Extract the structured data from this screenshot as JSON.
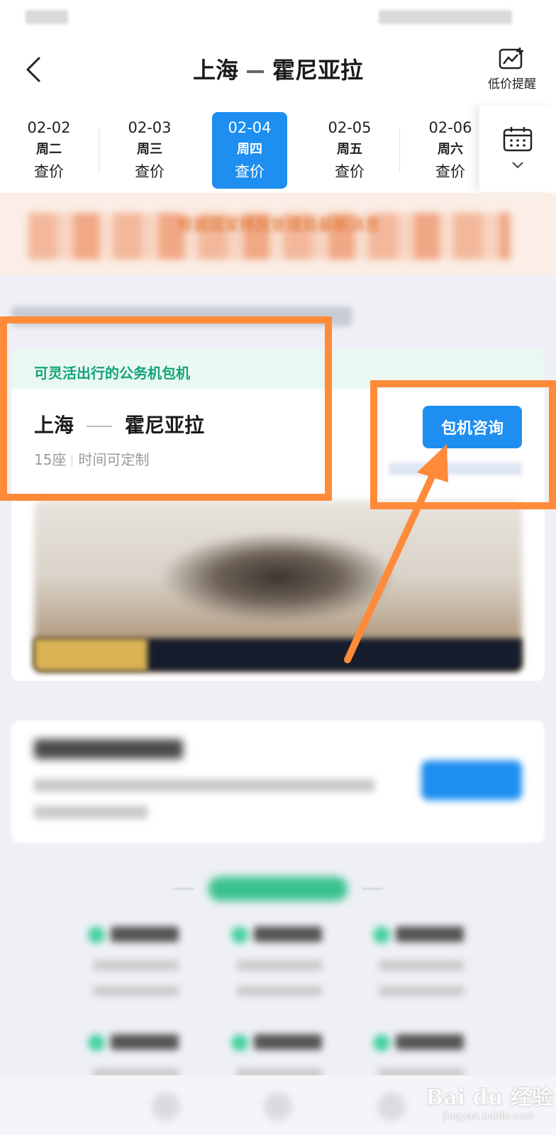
{
  "header": {
    "title_from": "上海",
    "title_to": "霍尼亚拉",
    "price_alert_label": "低价提醒"
  },
  "date_tabs": [
    {
      "date": "02-02",
      "weekday": "周二",
      "price": "查价",
      "active": false
    },
    {
      "date": "02-03",
      "weekday": "周三",
      "price": "查价",
      "active": false
    },
    {
      "date": "02-04",
      "weekday": "周四",
      "price": "查价",
      "active": true
    },
    {
      "date": "02-05",
      "weekday": "周五",
      "price": "查价",
      "active": false
    },
    {
      "date": "02-06",
      "weekday": "周六",
      "price": "查价",
      "active": false
    }
  ],
  "notice": {
    "text": "根据国家移民管理局最新消息"
  },
  "charter_card": {
    "tag": "可灵活出行的公务机包机",
    "from": "上海",
    "to": "霍尼亚拉",
    "seats": "15座",
    "time_note": "时间可定制",
    "button_label": "包机咨询"
  },
  "watermark": {
    "main": "Bai du 经验",
    "sub": "jingyan.baidu.com"
  },
  "colors": {
    "primary": "#1e8ef0",
    "tag_green": "#14a37a",
    "highlight_orange": "#ff8a3a",
    "notice_bg": "#fbeee6"
  },
  "icons": [
    "back-arrow-icon",
    "price-chart-plus-icon",
    "calendar-icon",
    "chevron-down-icon"
  ]
}
